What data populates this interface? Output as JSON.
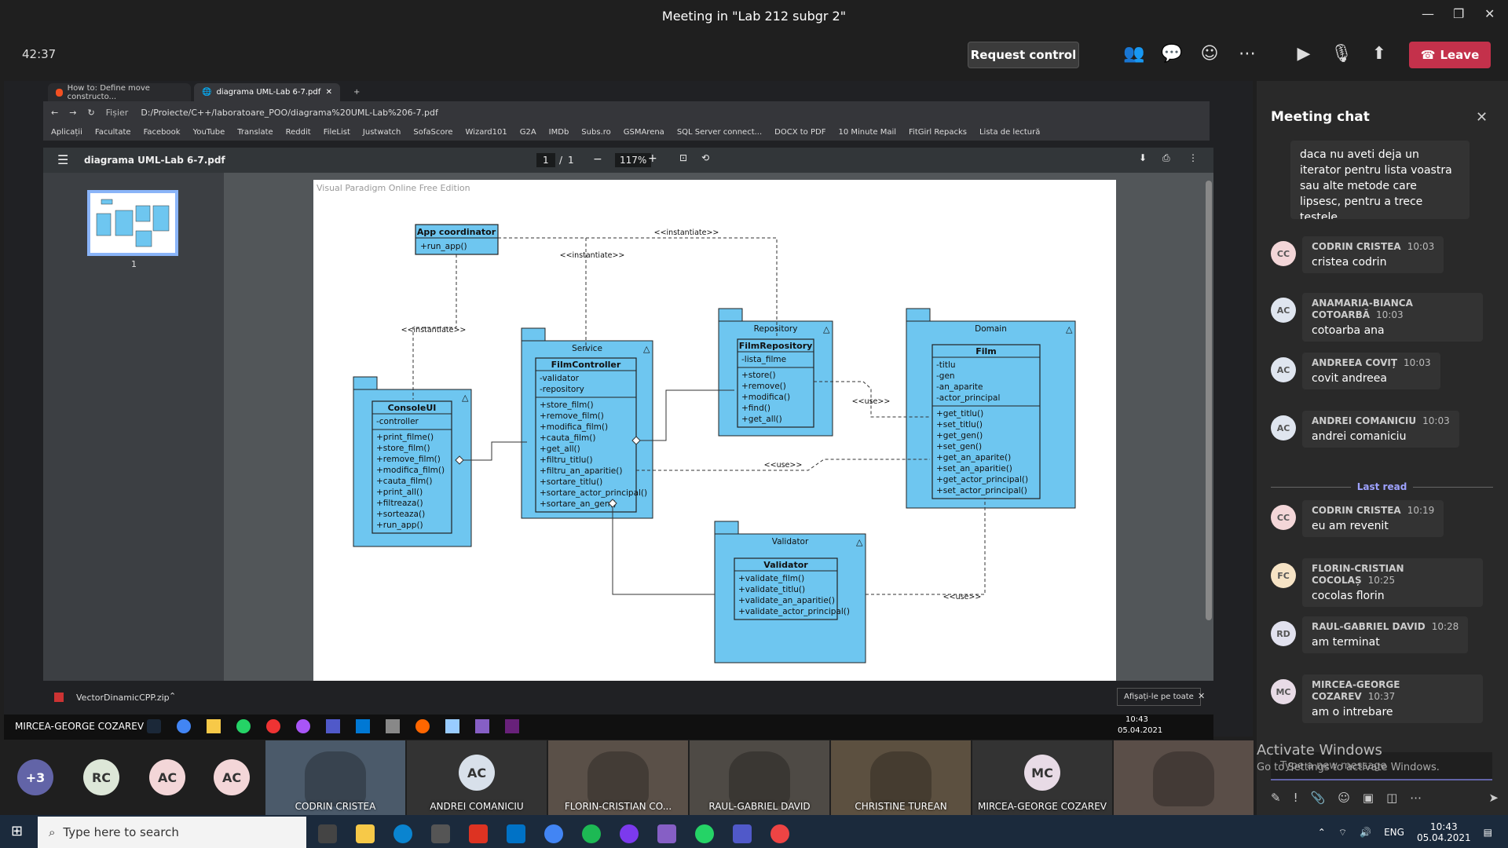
{
  "window": {
    "title": "Meeting in \"Lab 212 subgr 2\""
  },
  "topbar": {
    "timer": "42:37",
    "request_control": "Request control",
    "leave": "Leave"
  },
  "browser": {
    "tabs": [
      {
        "label": "How to: Define move constructo..."
      },
      {
        "label": "diagrama UML-Lab 6-7.pdf"
      }
    ],
    "address_prefix": "Fișier",
    "address": "D:/Proiecte/C++/laboratoare_POO/diagrama%20UML-Lab%206-7.pdf",
    "bookmarks": [
      "Aplicații",
      "Facultate",
      "Facebook",
      "YouTube",
      "Translate",
      "Reddit",
      "FileList",
      "Justwatch",
      "SofaScore",
      "Wizard101",
      "G2A",
      "IMDb",
      "Subs.ro",
      "GSMArena",
      "SQL Server connect...",
      "DOCX to PDF",
      "10 Minute Mail",
      "FitGirl Repacks",
      "Lista de lectură"
    ]
  },
  "pdf": {
    "filename": "diagrama UML-Lab 6-7.pdf",
    "page_current": "1",
    "page_sep": "/",
    "page_total": "1",
    "zoom": "117%",
    "thumb_label": "1",
    "watermark": "Visual Paradigm Online Free Edition"
  },
  "uml": {
    "app_coordinator": {
      "title": "App coordinator",
      "ops": [
        "+run_app()"
      ]
    },
    "consoleui": {
      "package": "",
      "title": "ConsoleUI",
      "attrs": [
        "-controller"
      ],
      "ops": [
        "+print_filme()",
        "+store_film()",
        "+remove_film()",
        "+modifica_film()",
        "+cauta_film()",
        "+print_all()",
        "+filtreaza()",
        "+sorteaza()",
        "+run_app()"
      ]
    },
    "service": {
      "package": "Service",
      "title": "FilmController",
      "attrs": [
        "-validator",
        "-repository"
      ],
      "ops": [
        "+store_film()",
        "+remove_film()",
        "+modifica_film()",
        "+cauta_film()",
        "+get_all()",
        "+filtru_titlu()",
        "+filtru_an_aparitie()",
        "+sortare_titlu()",
        "+sortare_actor_principal()",
        "+sortare_an_gen()"
      ]
    },
    "repository": {
      "package": "Repository",
      "title": "FilmRepository",
      "attrs": [
        "-lista_filme"
      ],
      "ops": [
        "+store()",
        "+remove()",
        "+modifica()",
        "+find()",
        "+get_all()"
      ]
    },
    "domain": {
      "package": "Domain",
      "title": "Film",
      "attrs": [
        "-titlu",
        "-gen",
        "-an_aparite",
        "-actor_principal"
      ],
      "ops": [
        "+get_titlu()",
        "+set_titlu()",
        "+get_gen()",
        "+set_gen()",
        "+get_an_aparite()",
        "+set_an_aparitie()",
        "+get_actor_principal()",
        "+set_actor_principal()"
      ]
    },
    "validator": {
      "package": "Validator",
      "title": "Validator",
      "ops": [
        "+validate_film()",
        "+validate_titlu()",
        "+validate_an_aparitie()",
        "+validate_actor_principal()"
      ]
    },
    "labels": {
      "instantiate": "<<instantiate>>",
      "use": "<<use>>"
    }
  },
  "downloads": {
    "file": "VectorDinamicCPP.zip",
    "show_all": "Afișați-le pe toate"
  },
  "inner_taskbar": {
    "presenter": "MIRCEA-GEORGE COZAREV",
    "time": "10:43",
    "date": "05.04.2021"
  },
  "gallery": {
    "overflow": "+3",
    "avatars": [
      "RC",
      "AC",
      "AC"
    ],
    "tiles": [
      {
        "name": "CODRIN CRISTEA",
        "kind": "video"
      },
      {
        "name": "ANDREI COMANICIU",
        "kind": "avatar",
        "initials": "AC"
      },
      {
        "name": "FLORIN-CRISTIAN CO...",
        "kind": "video"
      },
      {
        "name": "RAUL-GABRIEL DAVID",
        "kind": "video"
      },
      {
        "name": "CHRISTINE TUREAN",
        "kind": "video"
      },
      {
        "name": "MIRCEA-GEORGE COZAREV",
        "kind": "avatar",
        "initials": "MC"
      },
      {
        "name": "",
        "kind": "video"
      }
    ]
  },
  "chat": {
    "title": "Meeting chat",
    "top_text": "daca nu aveti deja un iterator pentru lista voastra sau alte metode care lipsesc, pentru a trece testele.",
    "last_read": "Last read",
    "messages": [
      {
        "initials": "CC",
        "name": "CODRIN CRISTEA",
        "time": "10:03",
        "text": "cristea codrin"
      },
      {
        "initials": "AC",
        "name": "ANAMARIA-BIANCA COTOARBĂ",
        "time": "10:03",
        "text": "cotoarba ana"
      },
      {
        "initials": "AC",
        "name": "ANDREEA COVIȚ",
        "time": "10:03",
        "text": "covit andreea"
      },
      {
        "initials": "AC",
        "name": "ANDREI COMANICIU",
        "time": "10:03",
        "text": "andrei comaniciu"
      },
      {
        "initials": "CC",
        "name": "CODRIN CRISTEA",
        "time": "10:19",
        "text": "eu am revenit"
      },
      {
        "initials": "FC",
        "name": "FLORIN-CRISTIAN COCOLAȘ",
        "time": "10:25",
        "text": "cocolas florin"
      },
      {
        "initials": "RD",
        "name": "RAUL-GABRIEL DAVID",
        "time": "10:28",
        "text": "am terminat"
      },
      {
        "initials": "MC",
        "name": "MIRCEA-GEORGE COZAREV",
        "time": "10:37",
        "text": "am o intrebare"
      }
    ],
    "input_placeholder": "Type a new message"
  },
  "watermark": {
    "line1": "Activate Windows",
    "line2": "Go to Settings to activate Windows."
  },
  "taskbar": {
    "search_placeholder": "Type here to search",
    "lang": "ENG",
    "time": "10:43",
    "date": "05.04.2021"
  },
  "colors": {
    "teams_bg": "#1f1f1f",
    "leave": "#c4314b",
    "uml_fill": "#6ec6f0",
    "uml_stroke": "#222222",
    "accent": "#6264a7"
  }
}
